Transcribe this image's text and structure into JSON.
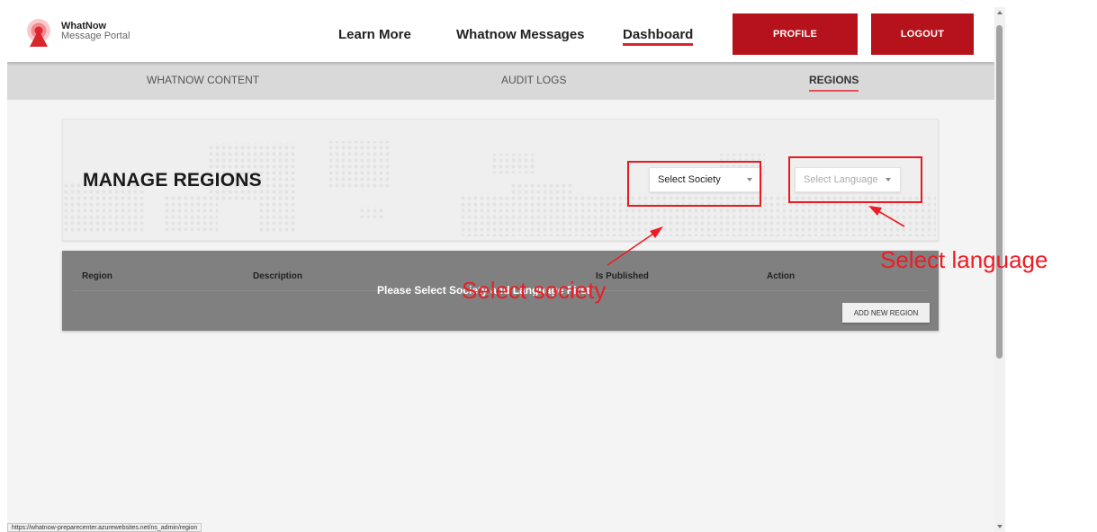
{
  "header": {
    "logo_title": "WhatNow",
    "logo_subtitle": "Message Portal",
    "nav": {
      "learn_more": "Learn More",
      "messages": "Whatnow Messages",
      "dashboard": "Dashboard"
    },
    "profile_label": "PROFILE",
    "logout_label": "LOGOUT",
    "brand_color": "#b5121b"
  },
  "subnav": {
    "tabs": [
      {
        "label": "WHATNOW CONTENT"
      },
      {
        "label": "AUDIT LOGS"
      },
      {
        "label": "REGIONS"
      }
    ]
  },
  "manage": {
    "title": "MANAGE REGIONS",
    "society_select": "Select Society",
    "language_select": "Select Language"
  },
  "table": {
    "headers": [
      "Region",
      "Description",
      "Is Published",
      "Action"
    ],
    "message": "Please Select Society and Language First",
    "add_button": "ADD NEW REGION"
  },
  "status": {
    "url": "https://whatnow-preparecenter.azurewebsites.net/ns_admin/region"
  },
  "annotations": {
    "society_label": "Select society",
    "language_label": "Select language",
    "color": "#ed1c24"
  }
}
